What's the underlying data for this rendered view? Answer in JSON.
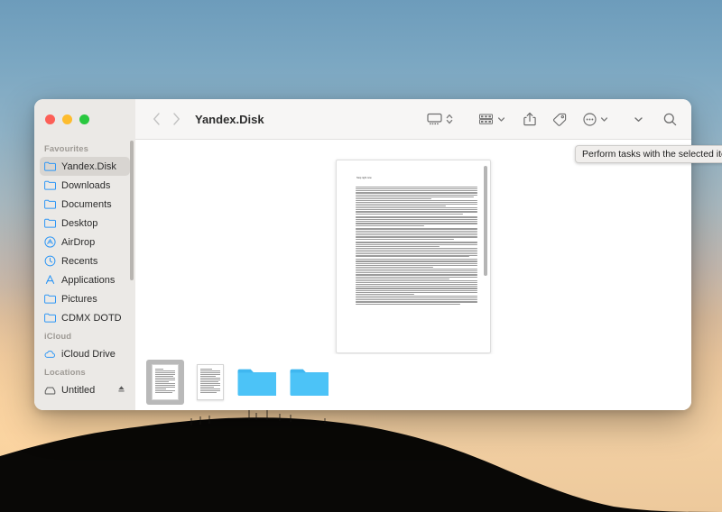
{
  "desktop": {
    "wallpaper_name": "sunset-hill-wallpaper",
    "sky_top_color": "#6d9cbb",
    "sky_bottom_color": "#f0cc9f",
    "hill_color": "#090806"
  },
  "window": {
    "title": "Yandex.Disk",
    "traffic_lights": {
      "close_label": "Close",
      "close_color": "#fc5f57",
      "minimize_label": "Minimize",
      "minimize_color": "#fdbc2e",
      "zoom_label": "Zoom",
      "zoom_color": "#29c83f"
    }
  },
  "toolbar": {
    "back_label": "Back",
    "forward_label": "Forward",
    "view_label": "View",
    "group_label": "Group",
    "share_label": "Share",
    "tag_label": "Tags",
    "action_label": "Action",
    "more_label": "More",
    "search_label": "Search"
  },
  "tooltip": {
    "text": "Perform tasks with the selected items"
  },
  "sidebar": {
    "sections": [
      {
        "title": "Favourites",
        "items": [
          {
            "label": "Yandex.Disk",
            "icon": "folder-icon",
            "selected": true
          },
          {
            "label": "Downloads",
            "icon": "folder-icon",
            "selected": false
          },
          {
            "label": "Documents",
            "icon": "folder-icon",
            "selected": false
          },
          {
            "label": "Desktop",
            "icon": "folder-icon",
            "selected": false
          },
          {
            "label": "AirDrop",
            "icon": "airdrop-icon",
            "selected": false
          },
          {
            "label": "Recents",
            "icon": "clock-icon",
            "selected": false
          },
          {
            "label": "Applications",
            "icon": "applications-icon",
            "selected": false
          },
          {
            "label": "Pictures",
            "icon": "folder-icon",
            "selected": false
          },
          {
            "label": "CDMX DOTD",
            "icon": "folder-icon",
            "selected": false
          }
        ]
      },
      {
        "title": "iCloud",
        "items": [
          {
            "label": "iCloud Drive",
            "icon": "cloud-icon",
            "selected": false
          }
        ]
      },
      {
        "title": "Locations",
        "items": [
          {
            "label": "Untitled",
            "icon": "disk-icon",
            "selected": false,
            "eject": true
          }
        ]
      }
    ]
  },
  "gallery": {
    "preview_name": "document-preview",
    "document_title": "Stop right now",
    "scrollbar_name": "preview-scrollbar"
  },
  "thumbnails": [
    {
      "name": "document-thumbnail-1",
      "type": "document",
      "selected": true
    },
    {
      "name": "document-thumbnail-2",
      "type": "document",
      "selected": false
    },
    {
      "name": "folder-thumbnail-1",
      "type": "folder",
      "selected": false
    },
    {
      "name": "folder-thumbnail-2",
      "type": "folder",
      "selected": false
    }
  ]
}
